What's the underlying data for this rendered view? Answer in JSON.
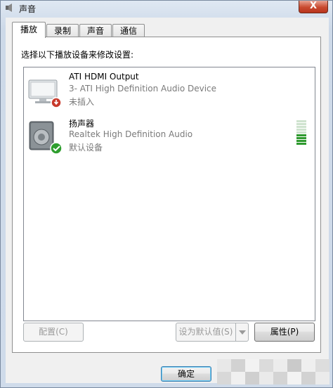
{
  "window": {
    "title": "声音",
    "close_label": "X"
  },
  "tabs": [
    {
      "label": "播放",
      "active": true
    },
    {
      "label": "录制",
      "active": false
    },
    {
      "label": "声音",
      "active": false
    },
    {
      "label": "通信",
      "active": false
    }
  ],
  "panel": {
    "instruction": "选择以下播放设备来修改设置:"
  },
  "devices": [
    {
      "name": "ATI HDMI Output",
      "detail": "3- ATI High Definition Audio Device",
      "status": "未插入",
      "icon": "monitor-icon",
      "badge": "unplugged-icon"
    },
    {
      "name": "扬声器",
      "detail": "Realtek High Definition Audio",
      "status": "默认设备",
      "icon": "speaker-icon",
      "badge": "default-check-icon",
      "level_segments_lit": 4,
      "level_segments_total": 9
    }
  ],
  "buttons": {
    "configure": "配置(C)",
    "set_default": "设为默认值(S)",
    "properties": "属性(P)",
    "ok": "确定"
  },
  "colors": {
    "level_on": "#2f9a2f",
    "level_off": "#cfe3cf",
    "badge_green": "#2e9e2e",
    "badge_red": "#c83a2c"
  }
}
